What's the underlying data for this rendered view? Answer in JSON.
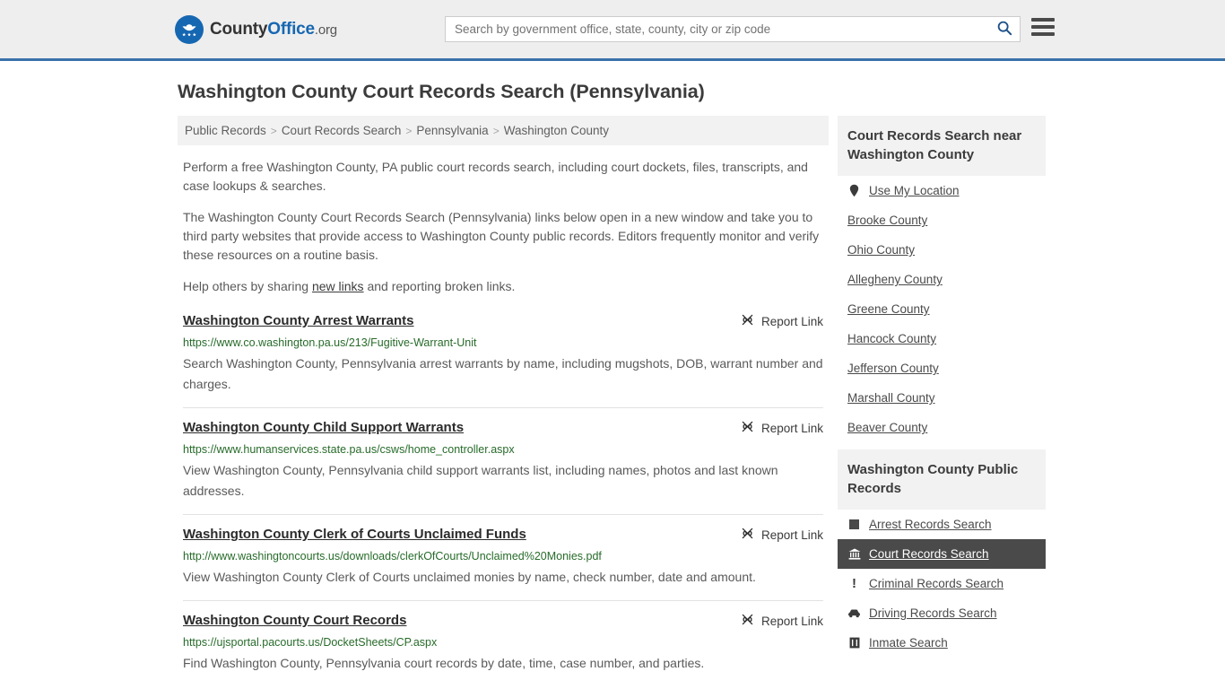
{
  "header": {
    "logo": {
      "icon": "eagle-seal-icon",
      "part1": "County",
      "part2": "Office",
      "part3": ".org"
    },
    "search": {
      "placeholder": "Search by government office, state, county, city or zip code",
      "value": "",
      "button_icon": "search-icon"
    },
    "menu_icon": "hamburger-menu-icon",
    "accent_color": "#3a72ab",
    "background_color": "#eeeeee"
  },
  "page": {
    "title": "Washington County Court Records Search (Pennsylvania)"
  },
  "breadcrumb": {
    "separator": ">",
    "items": [
      {
        "label": "Public Records"
      },
      {
        "label": "Court Records Search"
      },
      {
        "label": "Pennsylvania"
      },
      {
        "label": "Washington County"
      }
    ]
  },
  "intro": {
    "paragraph1": "Perform a free Washington County, PA public court records search, including court dockets, files, transcripts, and case lookups & searches.",
    "paragraph2": "The Washington County Court Records Search (Pennsylvania) links below open in a new window and take you to third party websites that provide access to Washington County public records. Editors frequently monitor and verify these resources on a routine basis.",
    "paragraph3_pre": "Help others by sharing ",
    "paragraph3_link": "new links",
    "paragraph3_post": " and reporting broken links."
  },
  "results": {
    "report_label": "Report Link",
    "report_icon": "broken-link-icon",
    "url_color": "#276b2a",
    "items": [
      {
        "title": "Washington County Arrest Warrants",
        "url": "https://www.co.washington.pa.us/213/Fugitive-Warrant-Unit",
        "description": "Search Washington County, Pennsylvania arrest warrants by name, including mugshots, DOB, warrant number and charges."
      },
      {
        "title": "Washington County Child Support Warrants",
        "url": "https://www.humanservices.state.pa.us/csws/home_controller.aspx",
        "description": "View Washington County, Pennsylvania child support warrants list, including names, photos and last known addresses."
      },
      {
        "title": "Washington County Clerk of Courts Unclaimed Funds",
        "url": "http://www.washingtoncourts.us/downloads/clerkOfCourts/Unclaimed%20Monies.pdf",
        "description": "View Washington County Clerk of Courts unclaimed monies by name, check number, date and amount."
      },
      {
        "title": "Washington County Court Records",
        "url": "https://ujsportal.pacourts.us/DocketSheets/CP.aspx",
        "description": "Find Washington County, Pennsylvania court records by date, time, case number, and parties."
      }
    ]
  },
  "sidebar": {
    "nearby": {
      "heading": "Court Records Search near Washington County",
      "items": [
        {
          "label": "Use My Location",
          "icon": "map-pin-icon"
        },
        {
          "label": "Brooke County",
          "icon": ""
        },
        {
          "label": "Ohio County",
          "icon": ""
        },
        {
          "label": "Allegheny County",
          "icon": ""
        },
        {
          "label": "Greene County",
          "icon": ""
        },
        {
          "label": "Hancock County",
          "icon": ""
        },
        {
          "label": "Jefferson County",
          "icon": ""
        },
        {
          "label": "Marshall County",
          "icon": ""
        },
        {
          "label": "Beaver County",
          "icon": ""
        }
      ]
    },
    "public_records": {
      "heading": "Washington County Public Records",
      "items": [
        {
          "label": "Arrest Records Search",
          "icon": "square-icon",
          "active": false
        },
        {
          "label": "Court Records Search",
          "icon": "courthouse-icon",
          "active": true
        },
        {
          "label": "Criminal Records Search",
          "icon": "exclamation-icon",
          "active": false
        },
        {
          "label": "Driving Records Search",
          "icon": "car-icon",
          "active": false
        },
        {
          "label": "Inmate Search",
          "icon": "jail-icon",
          "active": false
        }
      ]
    }
  }
}
